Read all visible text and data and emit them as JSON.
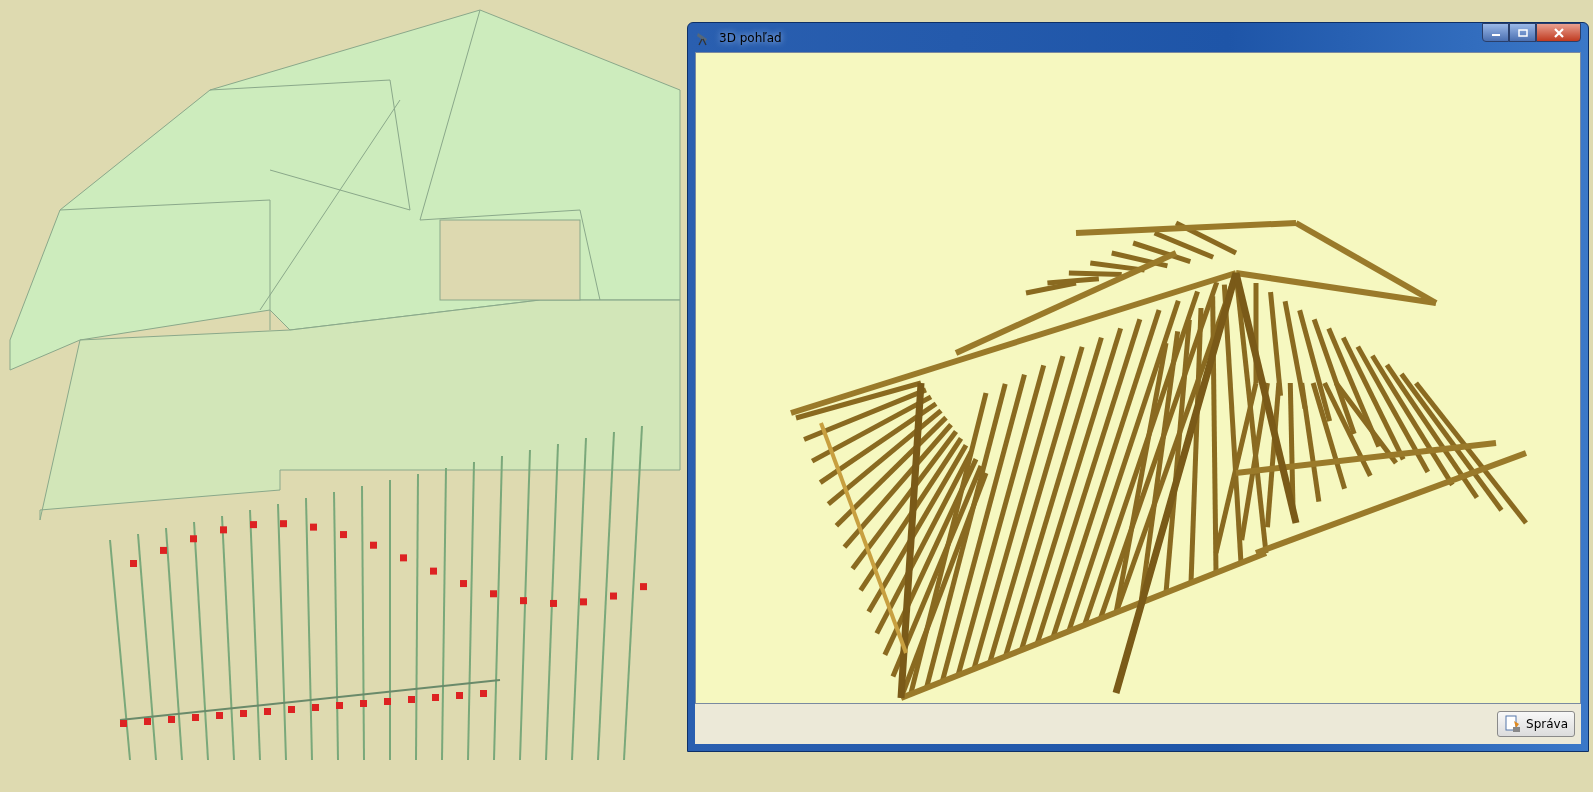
{
  "window": {
    "title": "3D pohľad"
  },
  "footer": {
    "button": "Správa"
  }
}
